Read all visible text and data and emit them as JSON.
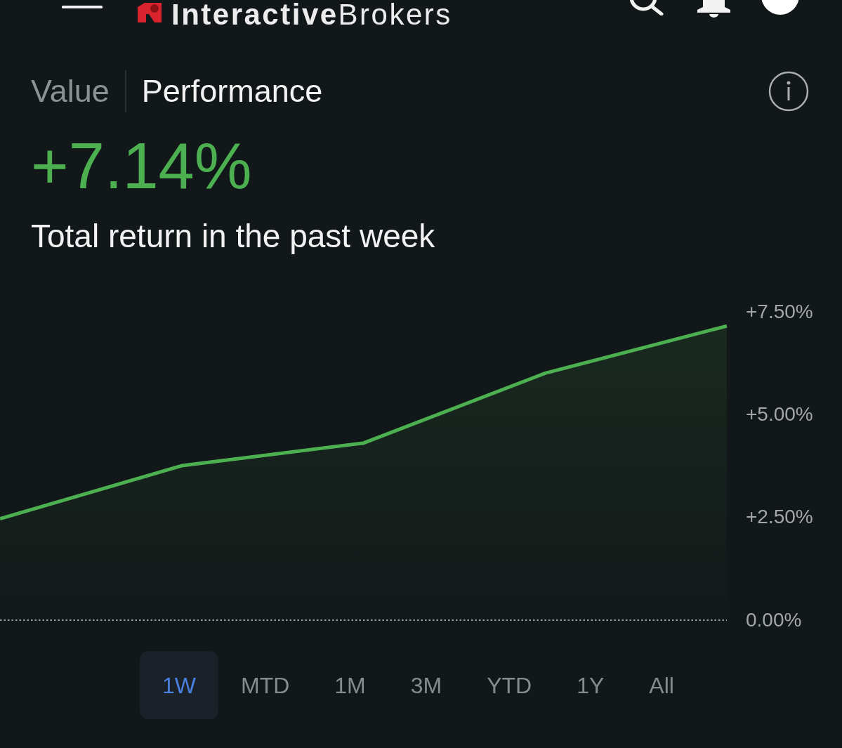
{
  "header": {
    "logo": "**Interactive**Brokers"
  },
  "view_tabs": [
    {
      "label": "Value",
      "selected": false
    },
    {
      "label": "Performance",
      "selected": true
    }
  ],
  "summary": {
    "value": "+7.14%",
    "caption": "Total return in the past week"
  },
  "chart": {
    "chart_data": {
      "type": "area",
      "series": [
        {
          "color": "#4caf50",
          "values": [
            2.45,
            3.74,
            4.29,
            5.99,
            7.14
          ]
        }
      ],
      "ylim": [
        0,
        7.5
      ],
      "yticks": [
        {
          "value": 0,
          "label": "0.00%"
        },
        {
          "value": 2.5,
          "label": "+2.50%"
        },
        {
          "value": 5,
          "label": "+5.00%"
        },
        {
          "value": 7.5,
          "label": "+7.50%"
        }
      ]
    }
  },
  "periods": [
    {
      "label": "1W",
      "selected": true
    },
    {
      "label": "MTD",
      "selected": false
    },
    {
      "label": "1M",
      "selected": false
    },
    {
      "label": "3M",
      "selected": false
    },
    {
      "label": "YTD",
      "selected": false
    },
    {
      "label": "1Y",
      "selected": false
    },
    {
      "label": "All",
      "selected": false
    }
  ]
}
